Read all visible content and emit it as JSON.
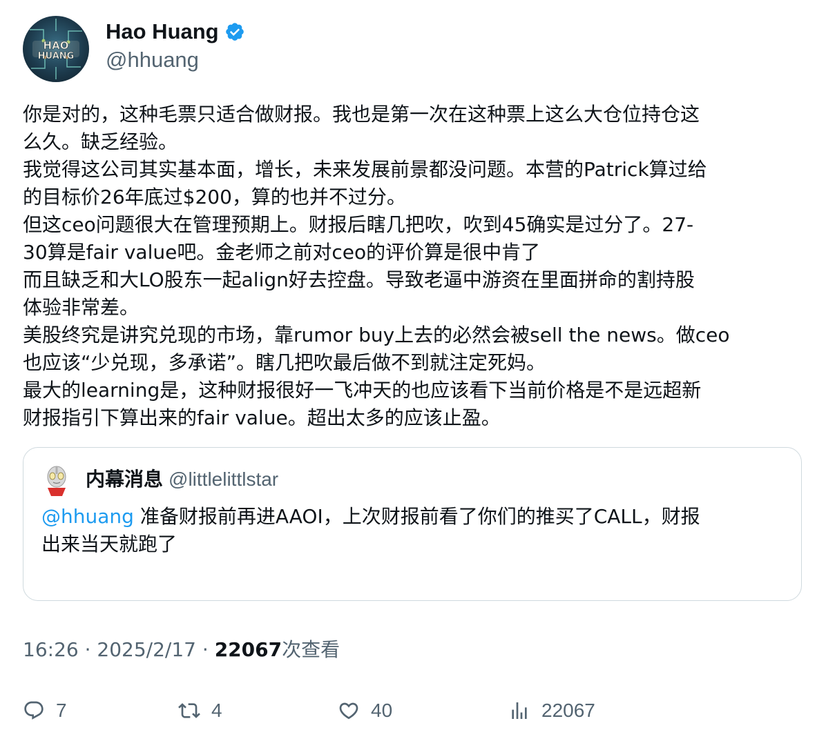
{
  "author": {
    "name": "Hao Huang",
    "handle": "@hhuang",
    "avatar_text": "HAO HUANG",
    "verified": true
  },
  "tweet": {
    "lines": [
      "你是对的，这种毛票只适合做财报。我也是第一次在这种票上这么大仓位持仓这",
      "么久。缺乏经验。",
      "我觉得这公司其实基本面，增长，未来发展前景都没问题。本营的Patrick算过给",
      "的目标价26年底过$200，算的也并不过分。",
      "但这ceo问题很大在管理预期上。财报后瞎几把吹，吹到45确实是过分了。27-",
      "30算是fair value吧。金老师之前对ceo的评价算是很中肯了",
      "而且缺乏和大LO股东一起align好去控盘。导致老逼中游资在里面拼命的割持股",
      "体验非常差。",
      "美股终究是讲究兑现的市场，靠rumor buy上去的必然会被sell the news。做ceo",
      "也应该“少兑现，多承诺”。瞎几把吹最后做不到就注定死妈。",
      "最大的learning是，这种财报很好一飞冲天的也应该看下当前价格是不是远超新",
      "财报指引下算出来的fair value。超出太多的应该止盈。"
    ]
  },
  "quote": {
    "name": "内幕消息",
    "handle": "@littlelittlstar",
    "mention": "@hhuang",
    "line1_rest": " 准备财报前再进AAOI，上次财报前看了你们的推买了CALL，财报",
    "line2": "出来当天就跑了"
  },
  "meta": {
    "time": "16:26",
    "separator": " · ",
    "date": "2025/2/17",
    "views": "22067",
    "views_label": "次查看"
  },
  "actions": {
    "replies": "7",
    "retweets": "4",
    "likes": "40",
    "views": "22067"
  },
  "colors": {
    "text": "#0f1419",
    "secondary": "#536471",
    "link": "#1d9bf0",
    "border": "#cfd9de",
    "verified": "#1d9bf0"
  }
}
